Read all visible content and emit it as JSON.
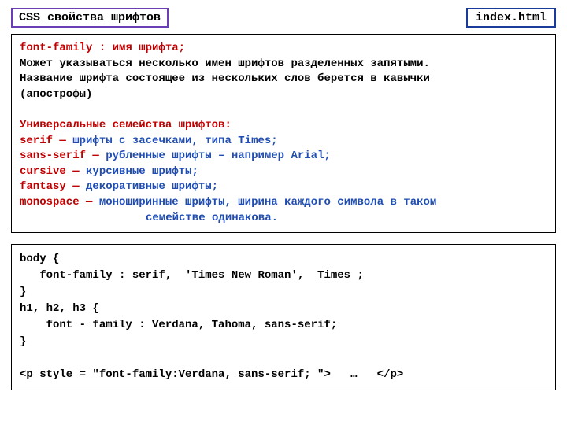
{
  "header": {
    "title": "CSS свойства шрифтов",
    "filename": "index.html"
  },
  "box1": {
    "l1_red": "font-family : имя шрифта;",
    "l2": "Может указываться  несколько имен шрифтов разделенных запятыми.",
    "l3": "Название шрифта состоящее из нескольких слов берется в кавычки",
    "l4": "(апострофы)",
    "heading": "Универсальные семейства шрифтов:",
    "f1_name": "serif",
    "f1_desc": "шрифты с засечками, типа Times;",
    "f2_name": "sans-serif",
    "f2_desc": "рубленные шрифты – например Arial;",
    "f3_name": "cursive",
    "f3_desc": "курсивные шрифты;",
    "f4_name": "fantasy",
    "f4_desc": "декоративные шрифты;",
    "f5_name": "monospace",
    "f5_desc1": "моноширинные шрифты, ширина каждого символа в таком",
    "f5_desc2": "семействе одинакова.",
    "dash": " — "
  },
  "box2": {
    "code": "body {\n   font-family : serif,  'Times New Roman',  Times ;\n}\nh1, h2, h3 {\n    font - family : Verdana, Tahoma, sans-serif;\n}\n\n<p style = \"font-family:Verdana, sans-serif; \">   …   </p>"
  }
}
